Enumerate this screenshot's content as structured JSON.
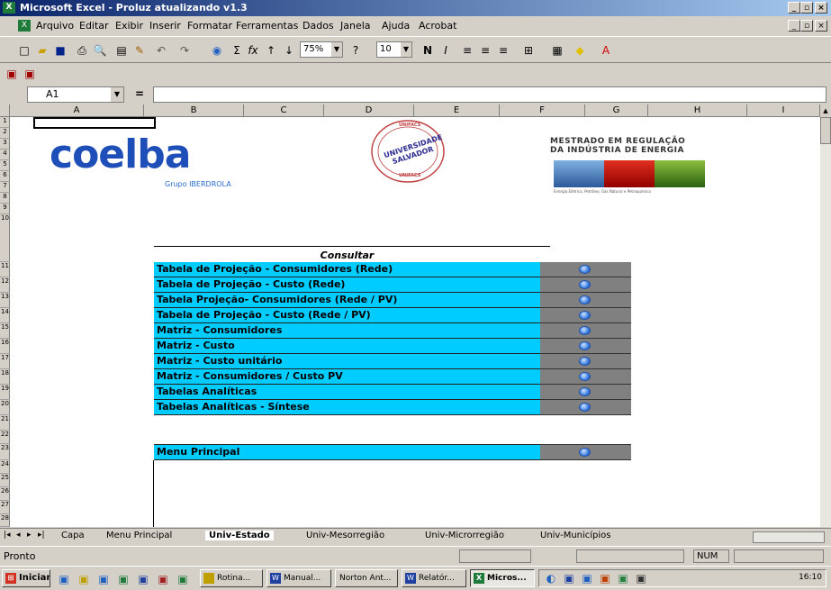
{
  "window": {
    "title": "Microsoft Excel - Proluz atualizando v1.3"
  },
  "menubar": [
    "Arquivo",
    "Editar",
    "Exibir",
    "Inserir",
    "Formatar",
    "Ferramentas",
    "Dados",
    "Janela",
    "Ajuda",
    "Acrobat"
  ],
  "toolbar": {
    "zoom": "75%",
    "font_size": "10"
  },
  "formula_bar": {
    "name_box": "A1",
    "equals": "="
  },
  "columns": [
    "A",
    "B",
    "C",
    "D",
    "E",
    "F",
    "G",
    "H",
    "I"
  ],
  "rows": [
    "1",
    "2",
    "3",
    "4",
    "5",
    "6",
    "7",
    "8",
    "9",
    "10",
    "11",
    "12",
    "13",
    "14",
    "15",
    "16",
    "17",
    "18",
    "19",
    "20",
    "21",
    "22",
    "23",
    "24",
    "25",
    "26",
    "27",
    "28"
  ],
  "logos": {
    "coelba": "coelba",
    "coelba_sub": "Grupo IBERDROLA",
    "unifacs_line1": "UNIVERSIDADE",
    "unifacs_line2": "SALVADOR",
    "unifacs_top": "UNIFACS",
    "unifacs_bottom": "UNIFACS",
    "mestrado_line1": "MESTRADO EM REGULAÇÃO",
    "mestrado_line2": "DA INDÚSTRIA DE ENERGIA",
    "mestrado_sub": "Energia Elétrica, Petróleo, Gás Natural e Petroquímica"
  },
  "consulta": {
    "header": "Consultar",
    "items": [
      "Tabela de Projeção - Consumidores (Rede)",
      "Tabela de Projeção - Custo (Rede)",
      "Tabela Projeção- Consumidores (Rede / PV)",
      "Tabela de Projeção - Custo (Rede / PV)",
      "Matriz - Consumidores",
      "Matriz - Custo",
      "Matriz - Custo unitário",
      "Matriz - Consumidores / Custo PV",
      "Tabelas Analíticas",
      "Tabelas Analíticas - Síntese"
    ],
    "main_menu": "Menu Principal"
  },
  "sheet_tabs": [
    "Capa",
    "Menu Principal",
    "Univ-Estado",
    "Univ-Mesorregião",
    "Univ-Microrregião",
    "Univ-Municípios"
  ],
  "active_sheet": "Univ-Estado",
  "status": {
    "left": "Pronto",
    "num": "NUM"
  },
  "taskbar": {
    "start": "Iniciar",
    "tasks": [
      "Rotina...",
      "Manual...",
      "Norton Ant...",
      "Relatór...",
      "Micros..."
    ],
    "clock": "16:10"
  }
}
